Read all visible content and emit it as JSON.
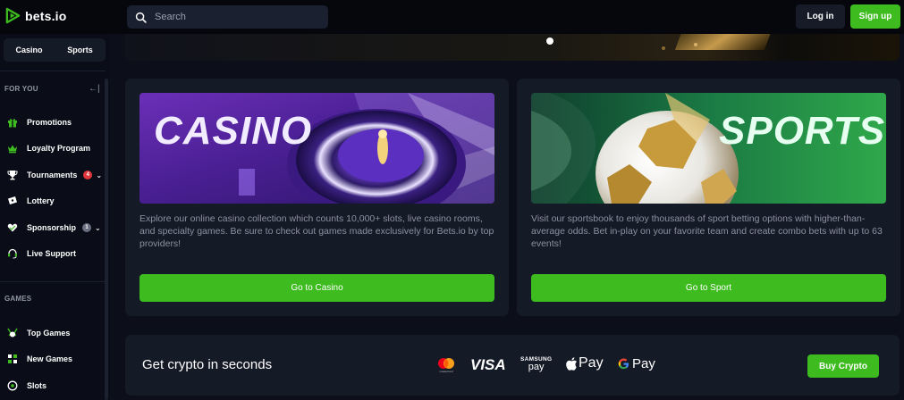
{
  "header": {
    "logo_text": "bets.io",
    "search_placeholder": "Search",
    "login_label": "Log in",
    "signup_label": "Sign up"
  },
  "sidebar": {
    "tabs": [
      "Casino",
      "Sports"
    ],
    "for_you_heading": "FOR YOU",
    "for_you_items": [
      {
        "label": "Promotions",
        "icon": "gift-icon"
      },
      {
        "label": "Loyalty Program",
        "icon": "crown-icon"
      },
      {
        "label": "Tournaments",
        "icon": "trophy-icon",
        "badge": "4",
        "badge_color": "#e0363b"
      },
      {
        "label": "Lottery",
        "icon": "ticket-icon"
      },
      {
        "label": "Sponsorship",
        "icon": "heart-handshake-icon",
        "badge": "1",
        "badge_color": "#6b7080"
      },
      {
        "label": "Live Support",
        "icon": "headset-icon"
      }
    ],
    "games_heading": "GAMES",
    "games_items": [
      {
        "label": "Top Games",
        "icon": "top-games-icon"
      },
      {
        "label": "New Games",
        "icon": "new-games-icon"
      },
      {
        "label": "Slots",
        "icon": "slots-icon"
      }
    ]
  },
  "cards": {
    "casino": {
      "banner_text": "CASINO",
      "description": "Explore our online casino collection which counts 10,000+ slots, live casino rooms, and specialty games. Be sure to check out games made exclusively for Bets.io by top providers!",
      "button_label": "Go to Casino"
    },
    "sports": {
      "banner_text": "SPORTS",
      "description": "Visit our sportsbook to enjoy thousands of sport betting options with higher-than-average odds. Bet in-play on your favorite team and create combo bets with up to 63 events!",
      "button_label": "Go to Sport"
    }
  },
  "crypto": {
    "title": "Get crypto in seconds",
    "payment_methods": {
      "mastercard_caption": "mastercard",
      "visa": "VISA",
      "samsung_top": "SAMSUNG",
      "samsung_bottom": "pay",
      "apple": "Pay",
      "google": "Pay"
    },
    "button_label": "Buy Crypto"
  },
  "colors": {
    "accent": "#3dbb1f",
    "background": "#0c0f1a",
    "card": "#151a27"
  }
}
